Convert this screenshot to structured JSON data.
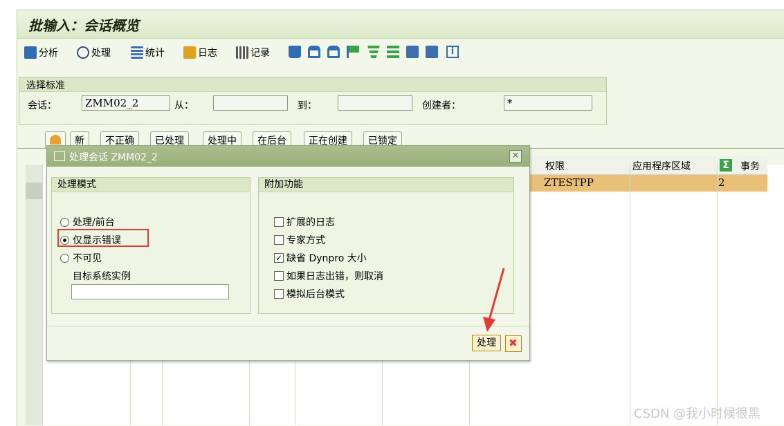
{
  "window": {
    "title": "批输入：会话概览"
  },
  "toolbar": {
    "analyze": "分析",
    "process": "处理",
    "statistics": "统计",
    "log": "日志",
    "record": "记录"
  },
  "criteria": {
    "group_label": "选择标准",
    "session_label": "会话：",
    "session_value": "ZMM02_2",
    "from_label": "从：",
    "from_value": "",
    "to_label": "到：",
    "to_value": "",
    "creator_label": "创建者：",
    "creator_value": "*"
  },
  "tabs": [
    "新",
    "不正确",
    "已处理",
    "处理中",
    "在后台",
    "正在创建",
    "已锁定"
  ],
  "grid": {
    "columns": [
      "权限",
      "应用程序区域",
      "事务"
    ],
    "rows": [
      {
        "auth": "ZTESTPP",
        "area": "",
        "tx": "2"
      }
    ]
  },
  "dialog": {
    "title": "处理会话 ZMM02_2",
    "mode_group": "处理模式",
    "modes": [
      "处理/前台",
      "仅显示错误",
      "不可见"
    ],
    "selected_mode": 1,
    "target_label": "目标系统实例",
    "target_value": "",
    "extra_group": "附加功能",
    "options": [
      {
        "label": "扩展的日志",
        "checked": false
      },
      {
        "label": "专家方式",
        "checked": false
      },
      {
        "label": "缺省 Dynpro 大小",
        "checked": true
      },
      {
        "label": "如果日志出错，则取消",
        "checked": false
      },
      {
        "label": "模拟后台模式",
        "checked": false
      }
    ],
    "process_button": "处理"
  },
  "watermark": "CSDN @我小时候很黑",
  "colors": {
    "highlight": "#e53935",
    "selected_row": "#e8c078",
    "dialog_title": "#a9bf8e"
  }
}
